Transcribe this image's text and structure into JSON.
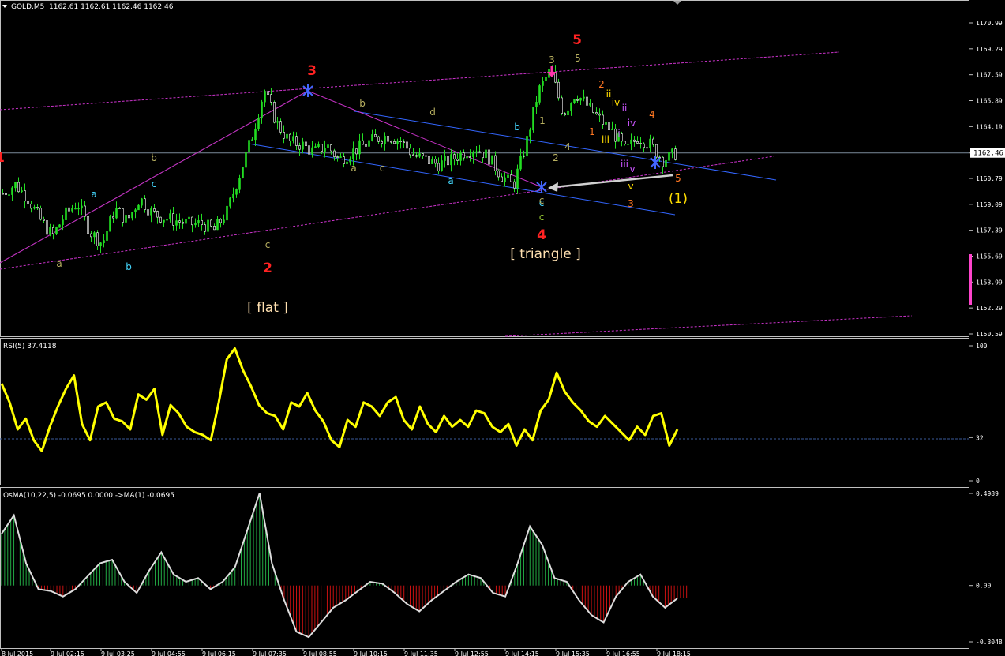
{
  "window": {
    "title": "GOLD,M5",
    "ohlc": "1162.61 1162.61 1162.46 1162.46"
  },
  "colors": {
    "background": "#000000",
    "candle_up": "#22dd22",
    "candle_down": "#ffffff",
    "rsi_line": "#ffff00",
    "osma_pos_hist": "#22aa44",
    "osma_neg_hist": "#cc1111",
    "osma_signal": "#dddddd",
    "channel_magenta": "#cc33cc",
    "channel_blue": "#3366ff",
    "bid_line": "#7a8a9a",
    "panel_border": "#c0c0c0",
    "label_red": "#ff2222",
    "label_yellow": "#ffdd00",
    "label_olive": "#b8b060",
    "label_cyan": "#44d8ff",
    "label_orange": "#ff7722",
    "label_violet": "#cc55ff",
    "label_green": "#99cc33",
    "label_cream": "#ffe0b0"
  },
  "price_axis": {
    "ticks": [
      "1170.99",
      "1169.29",
      "1167.59",
      "1165.89",
      "1164.19",
      "1162.46",
      "1160.79",
      "1159.09",
      "1157.39",
      "1155.69",
      "1153.99",
      "1152.29",
      "1150.59"
    ],
    "current": "1162.46",
    "range": [
      1150.2,
      1172.1
    ]
  },
  "time_axis": {
    "labels": [
      "8 Jul 2015",
      "9 Jul 02:15",
      "9 Jul 03:25",
      "9 Jul 04:55",
      "9 Jul 06:15",
      "9 Jul 07:35",
      "9 Jul 08:55",
      "9 Jul 10:15",
      "9 Jul 11:35",
      "9 Jul 12:55",
      "9 Jul 14:15",
      "9 Jul 15:35",
      "9 Jul 16:55",
      "9 Jul 18:15"
    ]
  },
  "rsi": {
    "title": "RSI(5) 37.4118",
    "ticks": [
      "100",
      "32",
      "0"
    ],
    "level": 32
  },
  "osma": {
    "title": "OsMA(10,22,5) -0.0695 0.0000 ->MA(1) -0.0695",
    "ticks": [
      "0.4989",
      "0.00",
      "-0.3048"
    ],
    "range": [
      -0.3048,
      0.4989
    ]
  },
  "annotations": [
    {
      "t": "1",
      "c": "label_red",
      "big": true
    },
    {
      "t": "2",
      "c": "label_red",
      "big": true
    },
    {
      "t": "3",
      "c": "label_red",
      "big": true
    },
    {
      "t": "4",
      "c": "label_red",
      "big": true
    },
    {
      "t": "5",
      "c": "label_red",
      "big": true
    },
    {
      "t": "(1)",
      "c": "label_yellow",
      "big": true
    },
    {
      "t": "[ flat ]",
      "c": "label_cream",
      "big": true
    },
    {
      "t": "[ triangle ]",
      "c": "label_cream",
      "big": true
    },
    {
      "t": "a",
      "c": "label_olive"
    },
    {
      "t": "b",
      "c": "label_olive"
    },
    {
      "t": "c",
      "c": "label_olive"
    },
    {
      "t": "a",
      "c": "label_cyan"
    },
    {
      "t": "b",
      "c": "label_cyan"
    },
    {
      "t": "c",
      "c": "label_cyan"
    },
    {
      "t": "c",
      "c": "label_green"
    },
    {
      "t": "b",
      "c": "label_olive"
    },
    {
      "t": "d",
      "c": "label_olive"
    },
    {
      "t": "a",
      "c": "label_olive"
    },
    {
      "t": "c",
      "c": "label_olive"
    },
    {
      "t": "b",
      "c": "label_cyan"
    },
    {
      "t": "a",
      "c": "label_cyan"
    },
    {
      "t": "c",
      "c": "label_cyan"
    },
    {
      "t": "c",
      "c": "label_olive"
    },
    {
      "t": "3",
      "c": "label_olive"
    },
    {
      "t": "5",
      "c": "label_olive"
    },
    {
      "t": "1",
      "c": "label_olive"
    },
    {
      "t": "2",
      "c": "label_olive"
    },
    {
      "t": "4",
      "c": "label_olive"
    },
    {
      "t": "2",
      "c": "label_orange"
    },
    {
      "t": "1",
      "c": "label_orange"
    },
    {
      "t": "3",
      "c": "label_orange"
    },
    {
      "t": "4",
      "c": "label_orange"
    },
    {
      "t": "5",
      "c": "label_orange"
    },
    {
      "t": "ii",
      "c": "label_yellow"
    },
    {
      "t": "iv",
      "c": "label_yellow"
    },
    {
      "t": "iii",
      "c": "label_yellow"
    },
    {
      "t": "v",
      "c": "label_yellow"
    },
    {
      "t": "ii",
      "c": "label_violet"
    },
    {
      "t": "iv",
      "c": "label_violet"
    },
    {
      "t": "i",
      "c": "label_violet"
    },
    {
      "t": "iii",
      "c": "label_violet"
    },
    {
      "t": "v",
      "c": "label_violet"
    }
  ],
  "chart_data": [
    {
      "type": "candlestick",
      "title": "GOLD,M5",
      "ylim": [
        1150.59,
        1170.99
      ],
      "wave_points": [
        {
          "label": "2",
          "price": 1157.5
        },
        {
          "label": "3",
          "price": 1166.6
        },
        {
          "label": "4",
          "price": 1160.3
        },
        {
          "label": "5",
          "price": 1167.9
        }
      ],
      "close_path": [
        1159.8,
        1160.4,
        1159.5,
        1158.1,
        1157.0,
        1158.4,
        1159.2,
        1157.3,
        1156.5,
        1158.8,
        1158.0,
        1159.5,
        1158.5,
        1158.2,
        1158.0,
        1157.8,
        1157.8,
        1157.4,
        1158.6,
        1161.0,
        1163.5,
        1166.6,
        1164.4,
        1163.2,
        1163.0,
        1162.5,
        1163.0,
        1162.0,
        1162.5,
        1163.0,
        1163.4,
        1163.6,
        1163.2,
        1162.3,
        1162.0,
        1161.7,
        1162.0,
        1162.5,
        1162.8,
        1162.2,
        1161.0,
        1160.3,
        1163.0,
        1166.5,
        1167.9,
        1165.0,
        1166.4,
        1165.5,
        1164.6,
        1163.8,
        1162.6,
        1163.5,
        1163.0,
        1162.0,
        1162.4
      ]
    },
    {
      "type": "line",
      "title": "RSI(5) 37.4118",
      "ylim": [
        0,
        100
      ],
      "level": 32,
      "values": [
        72,
        58,
        38,
        46,
        30,
        22,
        40,
        55,
        68,
        78,
        42,
        30,
        55,
        58,
        46,
        44,
        38,
        64,
        60,
        68,
        34,
        56,
        50,
        40,
        36,
        34,
        30,
        58,
        90,
        98,
        82,
        70,
        56,
        50,
        48,
        38,
        58,
        55,
        65,
        52,
        44,
        30,
        25,
        45,
        40,
        58,
        55,
        48,
        58,
        62,
        45,
        38,
        55,
        42,
        36,
        48,
        40,
        45,
        40,
        52,
        50,
        40,
        36,
        42,
        26,
        38,
        30,
        52,
        60,
        80,
        66,
        58,
        52,
        44,
        40,
        48,
        42,
        36,
        30,
        40,
        34,
        48,
        50,
        26,
        38
      ]
    },
    {
      "type": "bar",
      "title": "OsMA(10,22,5) -0.0695 0.0000 ->MA(1) -0.0695",
      "ylim": [
        -0.3048,
        0.4989
      ],
      "values": [
        0.28,
        0.38,
        0.12,
        -0.02,
        -0.03,
        -0.06,
        -0.02,
        0.05,
        0.12,
        0.14,
        0.02,
        -0.04,
        0.08,
        0.18,
        0.06,
        0.02,
        0.04,
        -0.02,
        0.02,
        0.1,
        0.3,
        0.5,
        0.12,
        -0.08,
        -0.25,
        -0.28,
        -0.2,
        -0.12,
        -0.08,
        -0.03,
        0.02,
        0.01,
        -0.04,
        -0.1,
        -0.14,
        -0.08,
        -0.03,
        0.02,
        0.06,
        0.04,
        -0.04,
        -0.06,
        0.12,
        0.32,
        0.22,
        0.04,
        0.02,
        -0.08,
        -0.16,
        -0.2,
        -0.06,
        0.02,
        0.06,
        -0.06,
        -0.12,
        -0.0695
      ]
    }
  ]
}
